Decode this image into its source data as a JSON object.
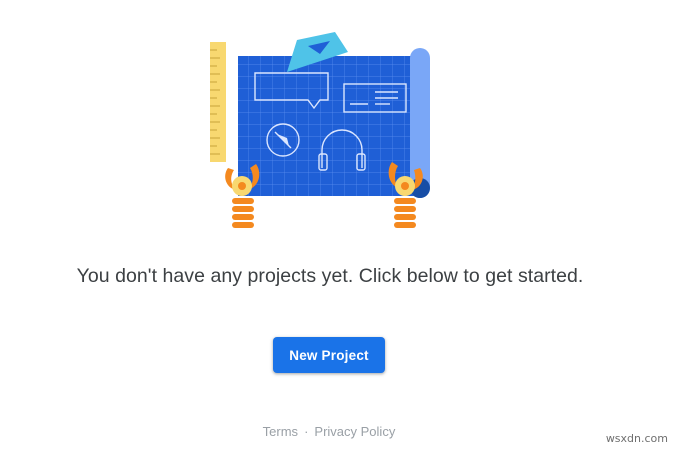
{
  "empty_state": {
    "message": "You don't have any projects yet. Click below to get started.",
    "new_project_label": "New Project"
  },
  "footer": {
    "terms_label": "Terms",
    "separator": "·",
    "privacy_label": "Privacy Policy"
  },
  "watermark": "wsxdn.com",
  "colors": {
    "accent": "#1a73e8",
    "blueprint": "#1f5fd6",
    "ruler": "#f8d870",
    "triangle": "#4fc3e8",
    "robot_arm": "#f4891f"
  }
}
